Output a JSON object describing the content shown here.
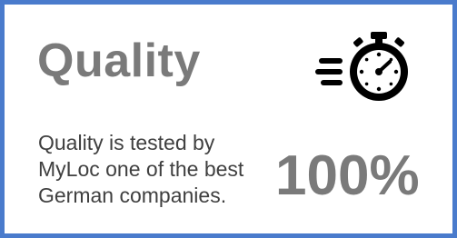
{
  "card": {
    "title": "Quality",
    "description_lines": [
      "Quality is tested by",
      "MyLoc one of the best",
      "German companies."
    ],
    "stat_value": "100%",
    "icon": "fast-stopwatch-icon",
    "colors": {
      "border": "#4a7bcc",
      "heading": "#7a7a7a",
      "body_text": "#404040",
      "icon": "#000000"
    }
  }
}
